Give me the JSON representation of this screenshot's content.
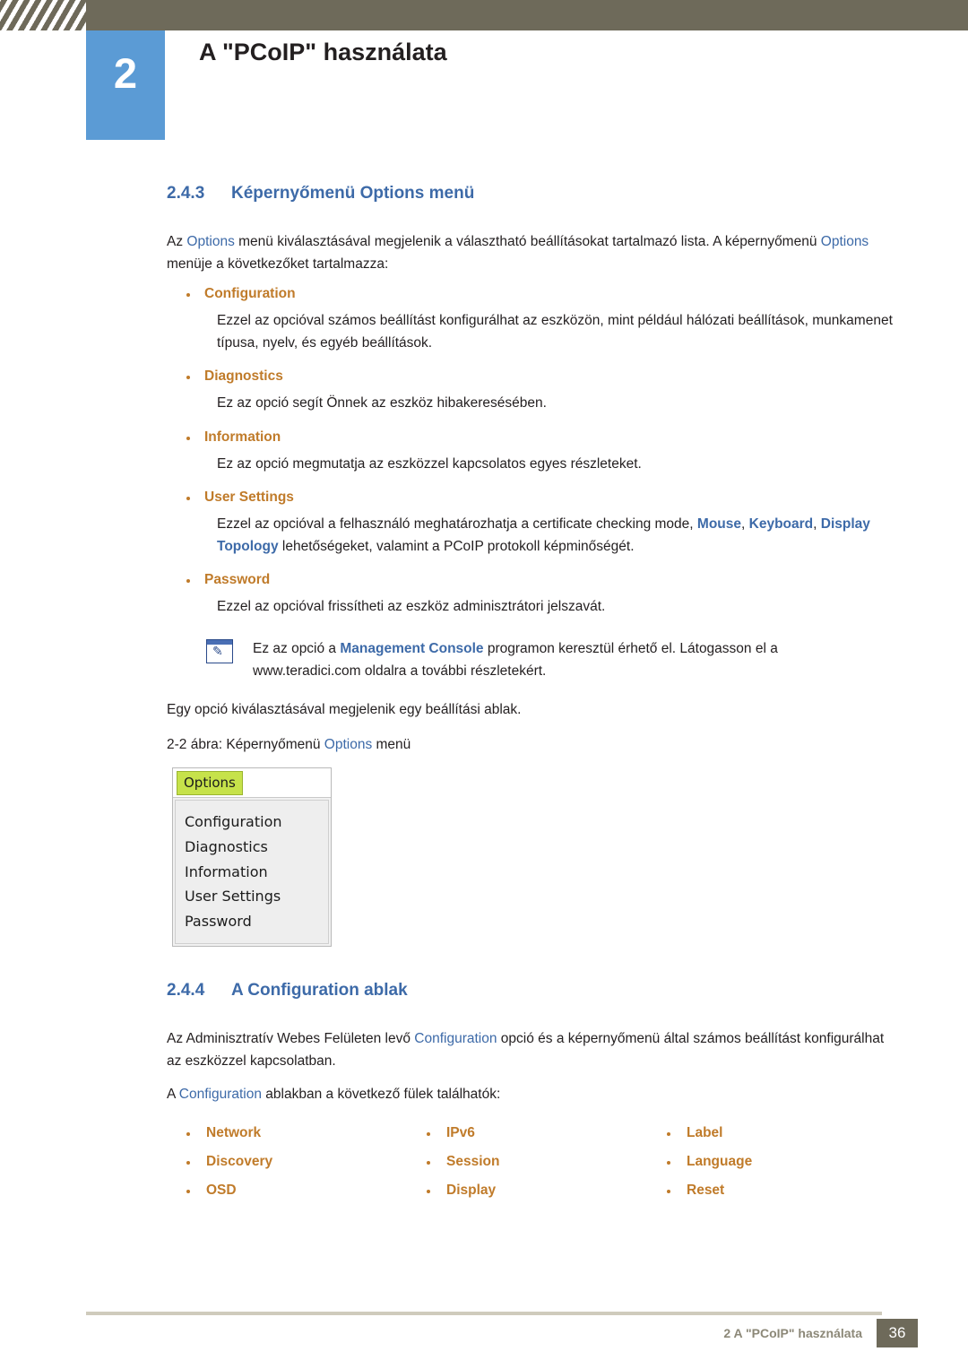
{
  "header": {
    "chapter_number": "2",
    "chapter_title": "A \"PCoIP\" használata"
  },
  "section_243": {
    "number": "2.4.3",
    "title": "Képernyőmenü Options menü",
    "intro_line1_a": "Az ",
    "intro_line1_kw": "Options",
    "intro_line1_b": " menü kiválasztásával megjelenik a választható beállításokat tartalmazó lista. A",
    "intro_line2_a": "képernyőmenü ",
    "intro_line2_kw": "Options",
    "intro_line2_b": " menüje a következőket tartalmazza:",
    "items": [
      {
        "label": "Configuration",
        "desc": "Ezzel az opcióval számos beállítást konfigurálhat az eszközön, mint például hálózati beállítások, munkamenet típusa, nyelv, és egyéb beállítások."
      },
      {
        "label": "Diagnostics",
        "desc": "Ez az opció segít Önnek az eszköz hibakeresésében."
      },
      {
        "label": "Information",
        "desc": "Ez az opció megmutatja az eszközzel kapcsolatos egyes részleteket."
      },
      {
        "label": "User Settings",
        "desc_a": "Ezzel az opcióval a felhasználó meghatározhatja a certificate checking mode, ",
        "desc_kw1": "Mouse",
        "desc_mid1": ", ",
        "desc_kw2": "Keyboard",
        "desc_mid2": ",",
        "desc_kw3": "Display Topology",
        "desc_b": " lehetőségeket, valamint a PCoIP protokoll képminőségét."
      },
      {
        "label": "Password",
        "desc": "Ezzel az opcióval frissítheti az eszköz adminisztrátori jelszavát."
      }
    ],
    "note": {
      "text_a": "Ez az opció a ",
      "kw": "Management Console",
      "text_b": " programon keresztül érhető el. Látogasson el a",
      "text_c": "www.teradici.com oldalra a további részletekért."
    },
    "after_note": "Egy opció kiválasztásával megjelenik egy beállítási ablak.",
    "figure_caption_a": "2-2 ábra: Képernyőmenü ",
    "figure_caption_kw": "Options",
    "figure_caption_b": " menü",
    "figure": {
      "tab_label": "Options",
      "menu_items": [
        "Configuration",
        "Diagnostics",
        "Information",
        "User Settings",
        "Password"
      ]
    }
  },
  "section_244": {
    "number": "2.4.4",
    "title": "A Configuration ablak",
    "para1_a": "Az Adminisztratív Webes Felületen levő ",
    "para1_kw": "Configuration",
    "para1_b": " opció és a képernyőmenü által számos beállítást",
    "para1_line2": "konfigurálhat az eszközzel kapcsolatban.",
    "para2_a": "A ",
    "para2_kw": "Configuration",
    "para2_b": " ablakban a következő fülek találhatók:",
    "tabs": [
      "Network",
      "IPv6",
      "Label",
      "Discovery",
      "Session",
      "Language",
      "OSD",
      "Display",
      "Reset"
    ]
  },
  "footer": {
    "text": "2 A \"PCoIP\" használata",
    "page": "36"
  }
}
